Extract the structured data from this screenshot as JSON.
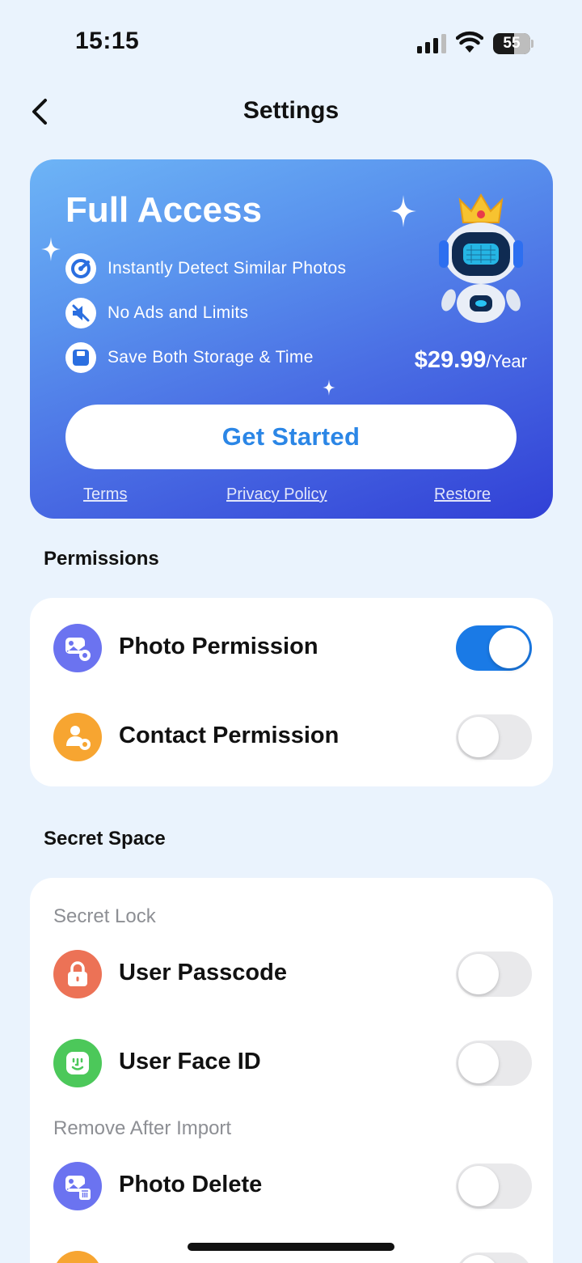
{
  "status_bar": {
    "time": "15:15",
    "battery": "55"
  },
  "nav": {
    "title": "Settings"
  },
  "promo": {
    "title": "Full Access",
    "features": [
      {
        "icon": "detect-icon",
        "label": "Instantly Detect Similar Photos"
      },
      {
        "icon": "no-ads-icon",
        "label": "No Ads and Limits"
      },
      {
        "icon": "storage-icon",
        "label": "Save Both Storage & Time"
      }
    ],
    "price": "$29.99",
    "price_period": "/Year",
    "cta": "Get Started",
    "links": {
      "terms": "Terms",
      "privacy": "Privacy Policy",
      "restore": "Restore"
    }
  },
  "permissions": {
    "title": "Permissions",
    "items": [
      {
        "icon": "photo-settings-icon",
        "label": "Photo Permission",
        "enabled": true
      },
      {
        "icon": "contact-settings-icon",
        "label": "Contact Permission",
        "enabled": false
      }
    ]
  },
  "secret_space": {
    "title": "Secret Space",
    "lock_subtitle": "Secret Lock",
    "lock_items": [
      {
        "icon": "lock-icon",
        "label": "User Passcode",
        "enabled": false
      },
      {
        "icon": "face-id-icon",
        "label": "User Face ID",
        "enabled": false
      }
    ],
    "remove_subtitle": "Remove After Import",
    "remove_items": [
      {
        "icon": "photo-delete-icon",
        "label": "Photo Delete",
        "enabled": false
      }
    ]
  },
  "colors": {
    "background": "#eaf3fd",
    "accent": "#1a7ae6",
    "photo_icon": "#6b73f0",
    "contact_icon": "#f7a531",
    "lock_icon": "#ec7256",
    "face_id_icon": "#4cc85a"
  }
}
